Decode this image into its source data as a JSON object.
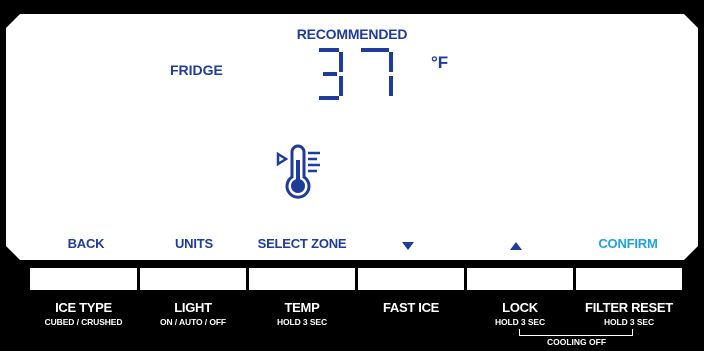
{
  "display": {
    "recommended": "RECOMMENDED",
    "zone": "FRIDGE",
    "temperature": "37",
    "unit": "°F",
    "icon": "thermometer-cooling-icon"
  },
  "softkeys": {
    "back": "BACK",
    "units": "UNITS",
    "select_zone": "SELECT ZONE",
    "down_icon": "triangle-down-icon",
    "up_icon": "triangle-up-icon",
    "confirm": "CONFIRM"
  },
  "buttons": [
    {
      "label": "ICE TYPE",
      "sub": "CUBED / CRUSHED"
    },
    {
      "label": "LIGHT",
      "sub": "ON / AUTO / OFF"
    },
    {
      "label": "TEMP",
      "sub": "HOLD 3 SEC"
    },
    {
      "label": "FAST ICE",
      "sub": ""
    },
    {
      "label": "LOCK",
      "sub": "HOLD 3 SEC"
    },
    {
      "label": "FILTER RESET",
      "sub": "HOLD 3 SEC"
    }
  ],
  "combo": {
    "cooling_off": "COOLING OFF"
  },
  "colors": {
    "display_text": "#1f3c9c",
    "confirm_text": "#1ea3e0",
    "panel": "#ffffff",
    "background": "#000000"
  }
}
